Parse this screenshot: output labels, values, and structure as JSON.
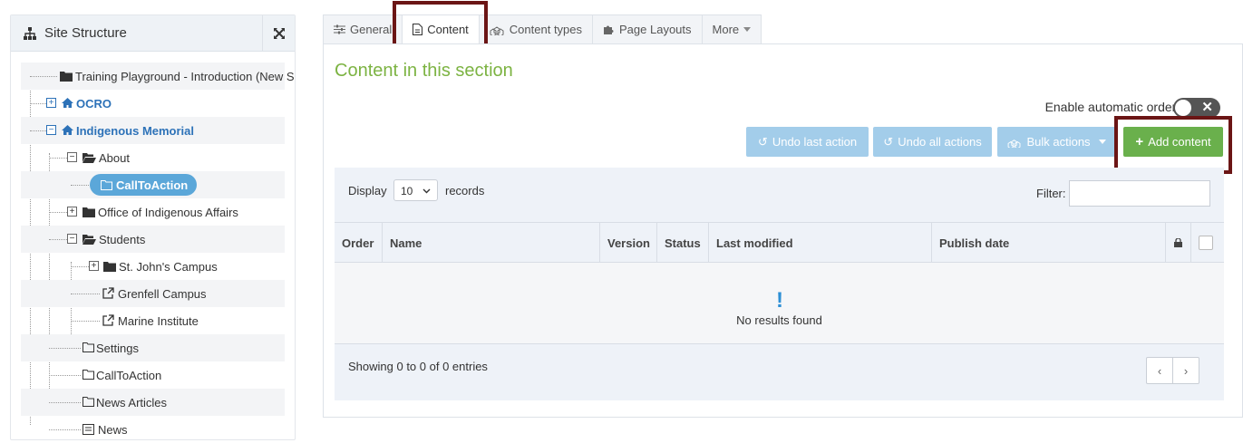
{
  "sidebar": {
    "title": "Site Structure",
    "items": [
      {
        "label": "Training Playground - Introduction (New S"
      },
      {
        "label": "OCRO"
      },
      {
        "label": "Indigenous Memorial"
      },
      {
        "label": "About"
      },
      {
        "label": "CallToAction"
      },
      {
        "label": "Office of Indigenous Affairs"
      },
      {
        "label": "Students"
      },
      {
        "label": "St. John's Campus"
      },
      {
        "label": "Grenfell Campus"
      },
      {
        "label": "Marine Institute"
      },
      {
        "label": "Settings"
      },
      {
        "label": "CallToAction"
      },
      {
        "label": "News Articles"
      },
      {
        "label": "News"
      }
    ]
  },
  "tabs": [
    {
      "label": "General"
    },
    {
      "label": "Content"
    },
    {
      "label": "Content types"
    },
    {
      "label": "Page Layouts"
    },
    {
      "label": "More"
    }
  ],
  "main": {
    "section_title": "Content in this section",
    "auto_ordering_label": "Enable automatic ordering",
    "undo_last": "Undo last action",
    "undo_all": "Undo all actions",
    "bulk_actions": "Bulk actions",
    "add_content": "Add content",
    "display_label": "Display",
    "display_value": "10",
    "records_label": "records",
    "filter_label": "Filter:",
    "columns": [
      "Order",
      "Name",
      "Version",
      "Status",
      "Last modified",
      "Publish date"
    ],
    "no_results": "No results found",
    "showing": "Showing 0 to 0 of 0 entries",
    "pager_prev": "‹",
    "pager_next": "›"
  },
  "colors": {
    "accent": "#5ba7d9",
    "success": "#6ab04c",
    "highlight_box": "#6b1515",
    "title_green": "#7cb342"
  }
}
